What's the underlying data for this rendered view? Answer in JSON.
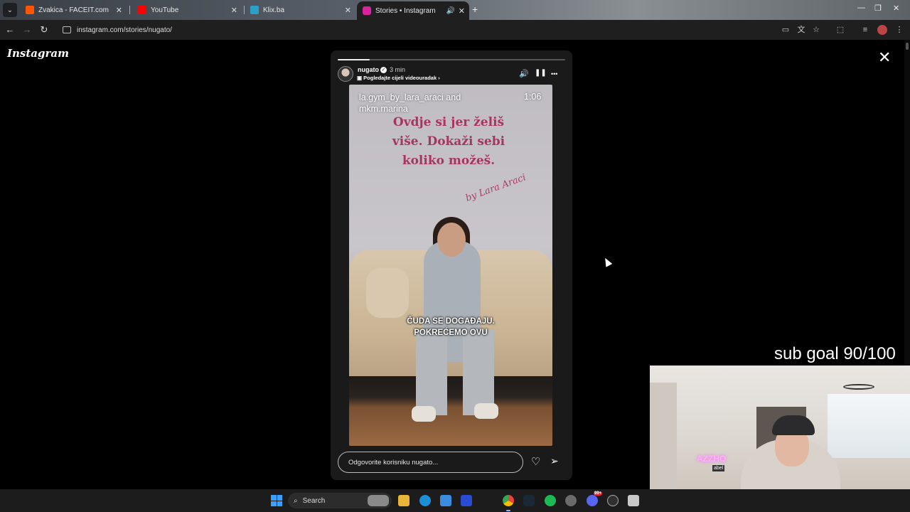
{
  "browser": {
    "tabs": [
      {
        "title": "Zvakica - FACEIT.com",
        "favicon_color": "#ff5500",
        "active": false
      },
      {
        "title": "YouTube",
        "favicon_color": "#ff0000",
        "active": false
      },
      {
        "title": "Klix.ba",
        "favicon_color": "#2aa0c8",
        "active": false
      },
      {
        "title": "Stories • Instagram",
        "favicon_color": "#d6249f",
        "active": true
      }
    ],
    "new_tab_icon": "plus-icon",
    "url": "instagram.com/stories/nugato/"
  },
  "instagram": {
    "logo": "Instagram",
    "close_icon": "✕",
    "story": {
      "progress": 0.14,
      "username": "nugato",
      "verified_glyph": "✓",
      "time": "3 min",
      "full_video_label": "Pogledajte cijeli videouradak",
      "full_video_arrow": "›",
      "media": {
        "caption": "la.gym_by_lara_araci and mkm.marina",
        "duration": "1:06",
        "wall_text": "Ovdje si jer želiš više. Dokaži sebi koliko možeš.",
        "wall_signature": "by Lara Araci",
        "subtitle_line1": "ČUDA SE DOGAĐAJU.",
        "subtitle_line2": "POKREĆEMO OVU"
      },
      "reply_placeholder": "Odgovorite korisniku nugato...",
      "controls": {
        "sound": "🔊",
        "pause": "❚❚",
        "more": "•••",
        "like": "♡",
        "share": "➢"
      }
    }
  },
  "overlay": {
    "sub_goal": "sub goal 90/100",
    "webcam_neon": "AZZHO",
    "webcam_sign": "abel"
  },
  "taskbar": {
    "search_label": "Search",
    "search_icon": "⌕",
    "apps": [
      "file-explorer",
      "edge",
      "store",
      "sketch-app",
      "chrome",
      "steam",
      "spotify",
      "settings",
      "discord",
      "obs",
      "tool"
    ],
    "badge_count": "99+"
  }
}
